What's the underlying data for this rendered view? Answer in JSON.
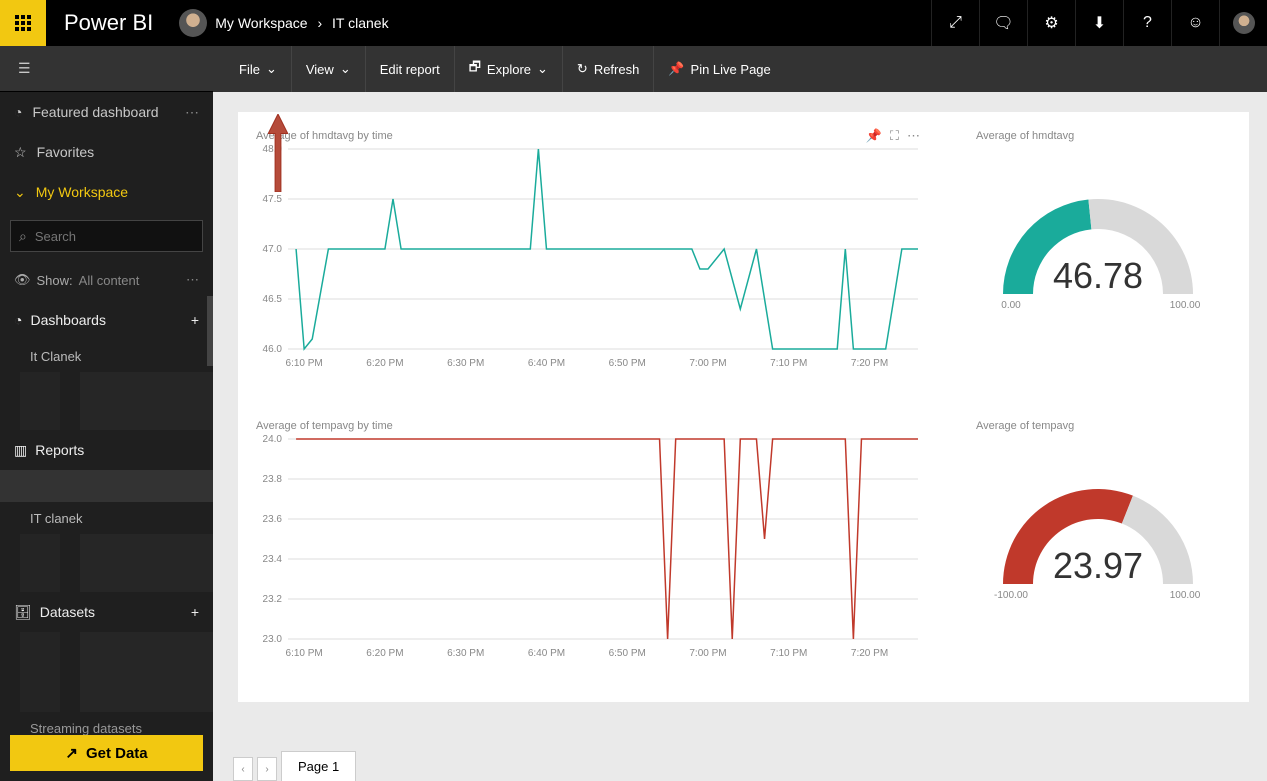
{
  "header": {
    "brand": "Power BI",
    "breadcrumb": [
      "My Workspace",
      "IT clanek"
    ]
  },
  "toolbar": {
    "file": "File",
    "view": "View",
    "edit": "Edit report",
    "explore": "Explore",
    "refresh": "Refresh",
    "pin": "Pin Live Page"
  },
  "sidebar": {
    "featured": "Featured dashboard",
    "favorites": "Favorites",
    "workspace": "My Workspace",
    "search_placeholder": "Search",
    "show_label": "Show:",
    "show_value": "All content",
    "dashboards": "Dashboards",
    "dash_item": "It Clanek",
    "reports": "Reports",
    "report_item": "IT clanek",
    "datasets": "Datasets",
    "streaming": "Streaming datasets",
    "getdata": "Get Data"
  },
  "pagebar": {
    "tab1": "Page 1"
  },
  "chart_data": [
    {
      "type": "line",
      "title": "Average of hmdtavg by time",
      "xlabel": "",
      "ylabel": "",
      "ylim": [
        46.0,
        48.0
      ],
      "x_ticks": [
        "6:10 PM",
        "6:20 PM",
        "6:30 PM",
        "6:40 PM",
        "6:50 PM",
        "7:00 PM",
        "7:10 PM",
        "7:20 PM"
      ],
      "y_ticks": [
        46.0,
        46.5,
        47.0,
        47.5,
        48.0
      ],
      "series": [
        {
          "name": "hmdtavg",
          "color": "#1aab9b",
          "values": [
            {
              "x": "6:09 PM",
              "y": 47.0
            },
            {
              "x": "6:10 PM",
              "y": 46.0
            },
            {
              "x": "6:11 PM",
              "y": 46.1
            },
            {
              "x": "6:13 PM",
              "y": 47.0
            },
            {
              "x": "6:19 PM",
              "y": 47.0
            },
            {
              "x": "6:20 PM",
              "y": 47.0
            },
            {
              "x": "6:21 PM",
              "y": 47.5
            },
            {
              "x": "6:22 PM",
              "y": 47.0
            },
            {
              "x": "6:38 PM",
              "y": 47.0
            },
            {
              "x": "6:39 PM",
              "y": 48.0
            },
            {
              "x": "6:40 PM",
              "y": 47.0
            },
            {
              "x": "6:58 PM",
              "y": 47.0
            },
            {
              "x": "6:59 PM",
              "y": 46.8
            },
            {
              "x": "7:00 PM",
              "y": 46.8
            },
            {
              "x": "7:02 PM",
              "y": 47.0
            },
            {
              "x": "7:04 PM",
              "y": 46.4
            },
            {
              "x": "7:06 PM",
              "y": 47.0
            },
            {
              "x": "7:08 PM",
              "y": 46.0
            },
            {
              "x": "7:16 PM",
              "y": 46.0
            },
            {
              "x": "7:17 PM",
              "y": 47.0
            },
            {
              "x": "7:18 PM",
              "y": 46.0
            },
            {
              "x": "7:22 PM",
              "y": 46.0
            },
            {
              "x": "7:24 PM",
              "y": 47.0
            },
            {
              "x": "7:26 PM",
              "y": 47.0
            }
          ]
        }
      ]
    },
    {
      "type": "line",
      "title": "Average of tempavg by time",
      "xlabel": "",
      "ylabel": "",
      "ylim": [
        23.0,
        24.0
      ],
      "x_ticks": [
        "6:10 PM",
        "6:20 PM",
        "6:30 PM",
        "6:40 PM",
        "6:50 PM",
        "7:00 PM",
        "7:10 PM",
        "7:20 PM"
      ],
      "y_ticks": [
        23.0,
        23.2,
        23.4,
        23.6,
        23.8,
        24.0
      ],
      "series": [
        {
          "name": "tempavg",
          "color": "#c0392b",
          "values": [
            {
              "x": "6:09 PM",
              "y": 24.0
            },
            {
              "x": "6:54 PM",
              "y": 24.0
            },
            {
              "x": "6:55 PM",
              "y": 23.0
            },
            {
              "x": "6:56 PM",
              "y": 24.0
            },
            {
              "x": "7:02 PM",
              "y": 24.0
            },
            {
              "x": "7:03 PM",
              "y": 23.0
            },
            {
              "x": "7:04 PM",
              "y": 24.0
            },
            {
              "x": "7:06 PM",
              "y": 24.0
            },
            {
              "x": "7:07 PM",
              "y": 23.5
            },
            {
              "x": "7:08 PM",
              "y": 24.0
            },
            {
              "x": "7:10 PM",
              "y": 24.0
            },
            {
              "x": "7:17 PM",
              "y": 24.0
            },
            {
              "x": "7:18 PM",
              "y": 23.0
            },
            {
              "x": "7:19 PM",
              "y": 24.0
            },
            {
              "x": "7:26 PM",
              "y": 24.0
            }
          ]
        }
      ]
    },
    {
      "type": "gauge",
      "title": "Average of hmdtavg",
      "value": 46.78,
      "min": 0.0,
      "max": 100.0,
      "color": "#1aab9b"
    },
    {
      "type": "gauge",
      "title": "Average of tempavg",
      "value": 23.97,
      "min": -100.0,
      "max": 100.0,
      "color": "#c0392b"
    }
  ]
}
